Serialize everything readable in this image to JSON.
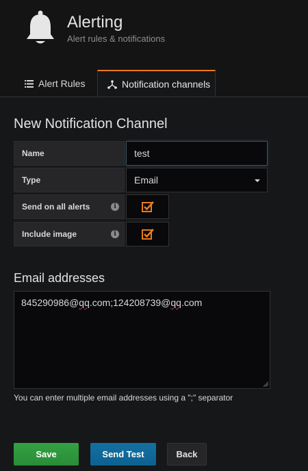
{
  "header": {
    "title": "Alerting",
    "subtitle": "Alert rules & notifications",
    "icon": "bell-icon"
  },
  "tabs": [
    {
      "label": "Alert Rules",
      "icon": "list-icon",
      "active": false
    },
    {
      "label": "Notification channels",
      "icon": "channels-icon",
      "active": true
    }
  ],
  "form": {
    "section_title": "New Notification Channel",
    "name_label": "Name",
    "name_value": "test",
    "type_label": "Type",
    "type_value": "Email",
    "send_all_label": "Send on all alerts",
    "send_all_checked": true,
    "include_image_label": "Include image",
    "include_image_checked": true,
    "info_glyph": "i"
  },
  "email": {
    "section_title": "Email addresses",
    "addresses_part1": "845290986@",
    "addresses_qq1": "qq",
    "addresses_part2": ".com;124208739@",
    "addresses_qq2": "qq",
    "addresses_part3": ".com",
    "help_text": "You can enter multiple email addresses using a \";\" separator"
  },
  "buttons": {
    "save": "Save",
    "send_test": "Send Test",
    "back": "Back"
  },
  "colors": {
    "accent_orange": "#eb7b18",
    "save_green": "#2f9a3f",
    "send_test_blue": "#1169a0"
  }
}
